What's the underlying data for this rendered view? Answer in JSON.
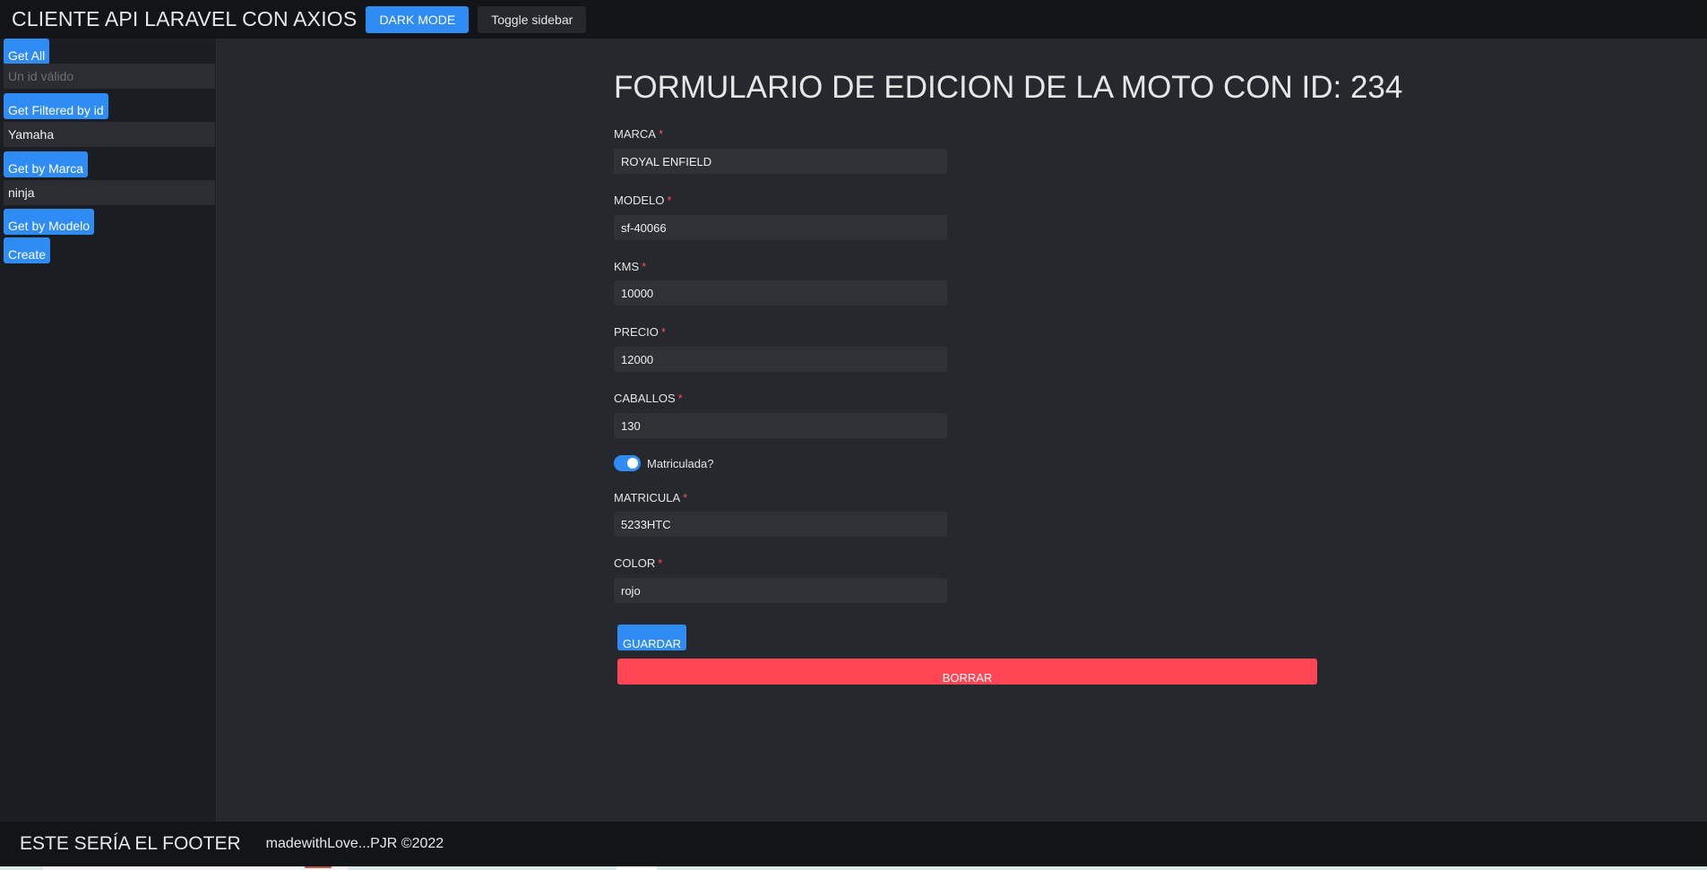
{
  "header": {
    "app_title": "CLIENTE API LARAVEL CON AXIOS",
    "dark_mode_label": "DARK MODE",
    "toggle_sidebar_label": "Toggle sidebar"
  },
  "sidebar": {
    "get_all_label": "Get All",
    "id_input_placeholder": "Un id válido",
    "get_filtered_label": "Get Filtered by id",
    "marca_input_value": "Yamaha",
    "get_by_marca_label": "Get by Marca",
    "modelo_input_value": "ninja",
    "get_by_modelo_label": "Get by Modelo",
    "create_label": "Create"
  },
  "form": {
    "title": "FORMULARIO DE EDICION DE LA MOTO CON ID: 234",
    "required_mark": "*",
    "fields": [
      {
        "label": "MARCA",
        "value": "ROYAL ENFIELD"
      },
      {
        "label": "MODELO",
        "value": "sf-40066"
      },
      {
        "label": "KMS",
        "value": "10000"
      },
      {
        "label": "PRECIO",
        "value": "12000"
      },
      {
        "label": "CABALLOS",
        "value": "130"
      },
      {
        "label": "MATRICULA",
        "value": "5233HTC"
      },
      {
        "label": "COLOR",
        "value": "rojo"
      }
    ],
    "matriculada_label": "Matriculada?",
    "matriculada_checked": true,
    "save_label": "GUARDAR",
    "delete_label": "BORRAR"
  },
  "footer": {
    "title": "ESTE SERÍA EL FOOTER",
    "credit": "madewithLove...PJR ©2022"
  },
  "colors": {
    "accent": "#2f8cf5",
    "danger": "#ff4655",
    "background": "#25282d",
    "bar": "#121518"
  }
}
